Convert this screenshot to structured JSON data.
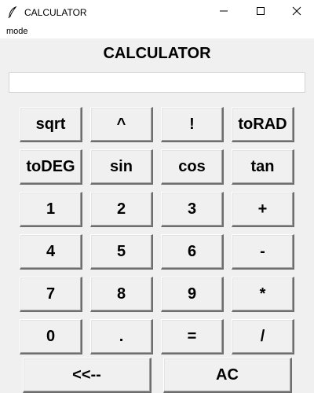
{
  "window": {
    "title": "CALCULATOR",
    "controls": {
      "minimize": "minimize",
      "maximize": "maximize",
      "close": "close"
    }
  },
  "menu": {
    "items": [
      "mode"
    ]
  },
  "heading": "CALCULATOR",
  "display": {
    "value": ""
  },
  "buttons": {
    "row1": [
      "sqrt",
      "^",
      "!",
      "toRAD"
    ],
    "row2": [
      "toDEG",
      "sin",
      "cos",
      "tan"
    ],
    "row3": [
      "1",
      "2",
      "3",
      "+"
    ],
    "row4": [
      "4",
      "5",
      "6",
      "-"
    ],
    "row5": [
      "7",
      "8",
      "9",
      "*"
    ],
    "row6": [
      "0",
      ".",
      "=",
      "/"
    ],
    "row7": [
      "<<--",
      "AC"
    ]
  },
  "icons": {
    "app": "feather-icon",
    "minimize": "minimize-icon",
    "maximize": "maximize-icon",
    "close": "close-icon"
  }
}
